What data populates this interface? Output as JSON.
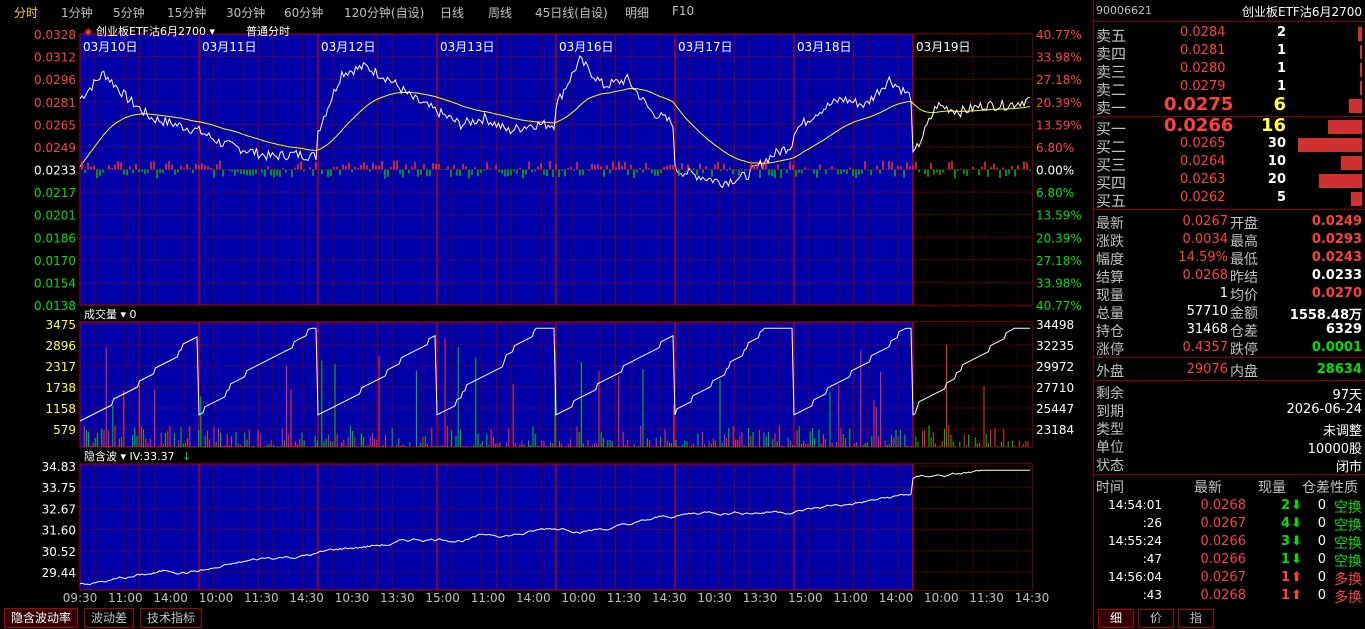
{
  "period_tabs": [
    "分时",
    "1分钟",
    "5分钟",
    "15分钟",
    "30分钟",
    "60分钟",
    "120分钟(自设)",
    "日线",
    "周线",
    "45日线(自设)",
    "明细",
    "F10"
  ],
  "chart_header": {
    "contract_name": "创业板ETF沽6月2700",
    "mode": "普通分时"
  },
  "dates": [
    "03月10日",
    "03月11日",
    "03月12日",
    "03月13日",
    "03月16日",
    "03月17日",
    "03月18日",
    "03月19日"
  ],
  "price_axis_left": [
    "0.0328",
    "0.0312",
    "0.0296",
    "0.0281",
    "0.0265",
    "0.0249",
    "0.0233",
    "0.0217",
    "0.0201",
    "0.0186",
    "0.0170",
    "0.0154",
    "0.0138"
  ],
  "price_axis_right": [
    "40.77%",
    "33.98%",
    "27.18%",
    "20.39%",
    "13.59%",
    "6.80%",
    "0.00%",
    "6.80%",
    "13.59%",
    "20.39%",
    "27.18%",
    "33.98%",
    "40.77%"
  ],
  "volume_panel": {
    "label": "成交量",
    "value": "0",
    "left_axis": [
      "3475",
      "2896",
      "2317",
      "1738",
      "1158",
      "579"
    ],
    "right_axis": [
      "34498",
      "32235",
      "29972",
      "27710",
      "25447",
      "23184"
    ]
  },
  "iv_panel": {
    "label": "隐含波",
    "value_label": "IV:33.37",
    "left_axis": [
      "34.83",
      "33.75",
      "32.67",
      "31.60",
      "30.52",
      "29.44"
    ]
  },
  "time_axis": [
    "09:30",
    "11:00",
    "14:00",
    "10:00",
    "11:30",
    "14:30",
    "10:30",
    "13:30",
    "15:00",
    "11:00",
    "14:00",
    "10:00",
    "11:30",
    "14:30",
    "10:30",
    "13:30",
    "15:00",
    "11:00",
    "14:00",
    "10:00",
    "11:30",
    "14:30"
  ],
  "bottom_tabs": [
    "隐含波动率",
    "波动差",
    "技术指标"
  ],
  "right_panel": {
    "code": "90006621",
    "name": "创业板ETF沽6月2700",
    "sell": [
      {
        "label": "卖五",
        "price": "0.0284",
        "vol": "2",
        "bar": 0.07
      },
      {
        "label": "卖四",
        "price": "0.0281",
        "vol": "1",
        "bar": 0.03
      },
      {
        "label": "卖三",
        "price": "0.0280",
        "vol": "1",
        "bar": 0.03
      },
      {
        "label": "卖二",
        "price": "0.0279",
        "vol": "1",
        "bar": 0.03
      },
      {
        "label": "卖一",
        "price": "0.0275",
        "vol": "6",
        "bar": 0.2
      }
    ],
    "buy": [
      {
        "label": "买一",
        "price": "0.0266",
        "vol": "16",
        "bar": 0.53
      },
      {
        "label": "买二",
        "price": "0.0265",
        "vol": "30",
        "bar": 1.0
      },
      {
        "label": "买三",
        "price": "0.0264",
        "vol": "10",
        "bar": 0.33
      },
      {
        "label": "买四",
        "price": "0.0263",
        "vol": "20",
        "bar": 0.67
      },
      {
        "label": "买五",
        "price": "0.0262",
        "vol": "5",
        "bar": 0.17
      }
    ],
    "stats": [
      {
        "l1": "最新",
        "v1": "0.0267",
        "c1": "red",
        "l2": "开盘",
        "v2": "0.0249",
        "c2": "red"
      },
      {
        "l1": "涨跌",
        "v1": "0.0034",
        "c1": "red",
        "l2": "最高",
        "v2": "0.0293",
        "c2": "red"
      },
      {
        "l1": "幅度",
        "v1": "14.59%",
        "c1": "red",
        "l2": "最低",
        "v2": "0.0243",
        "c2": "red"
      },
      {
        "l1": "结算",
        "v1": "0.0268",
        "c1": "red",
        "l2": "昨结",
        "v2": "0.0233",
        "c2": "white"
      },
      {
        "l1": "现量",
        "v1": "1",
        "c1": "white",
        "l2": "均价",
        "v2": "0.0270",
        "c2": "red"
      },
      {
        "l1": "总量",
        "v1": "57710",
        "c1": "white",
        "l2": "金额",
        "v2": "1558.48万",
        "c2": "white"
      },
      {
        "l1": "持仓",
        "v1": "31468",
        "c1": "white",
        "l2": "仓差",
        "v2": "6329",
        "c2": "white"
      },
      {
        "l1": "涨停",
        "v1": "0.4357",
        "c1": "red",
        "l2": "跌停",
        "v2": "0.0001",
        "c2": "green"
      }
    ],
    "outer": {
      "label": "外盘",
      "value": "29076"
    },
    "inner": {
      "label": "内盘",
      "value": "28634"
    },
    "info": [
      {
        "label": "剩余",
        "value": "97天"
      },
      {
        "label": "到期",
        "value": "2026-06-24"
      },
      {
        "label": "类型",
        "value": "未调整"
      },
      {
        "label": "单位",
        "value": "10000股"
      },
      {
        "label": "状态",
        "value": "闭市"
      }
    ],
    "trades_header": [
      "时间",
      "最新",
      "现量",
      "仓差",
      "性质"
    ],
    "trades": [
      {
        "time": "14:54:01",
        "price": "0.0268",
        "vol": "2",
        "dir": "down",
        "diff": "0",
        "nature": "空换",
        "ncolor": "green"
      },
      {
        "time": ":26",
        "price": "0.0267",
        "vol": "4",
        "dir": "down",
        "diff": "0",
        "nature": "空换",
        "ncolor": "green"
      },
      {
        "time": "14:55:24",
        "price": "0.0266",
        "vol": "3",
        "dir": "down",
        "diff": "0",
        "nature": "空换",
        "ncolor": "green"
      },
      {
        "time": ":47",
        "price": "0.0266",
        "vol": "1",
        "dir": "down",
        "diff": "0",
        "nature": "空换",
        "ncolor": "green"
      },
      {
        "time": "14:56:04",
        "price": "0.0267",
        "vol": "1",
        "dir": "up",
        "diff": "0",
        "nature": "多换",
        "ncolor": "red"
      },
      {
        "time": ":43",
        "price": "0.0268",
        "vol": "1",
        "dir": "up",
        "diff": "0",
        "nature": "多换",
        "ncolor": "red"
      }
    ],
    "side_tabs": [
      "细",
      "价",
      "指"
    ]
  },
  "colors": {
    "panel_bg": "#0000a8",
    "grid": "#a00000",
    "price_line": "#ffffff",
    "avg_line": "#ffff00",
    "up": "#ff3030",
    "down": "#00c000"
  }
}
